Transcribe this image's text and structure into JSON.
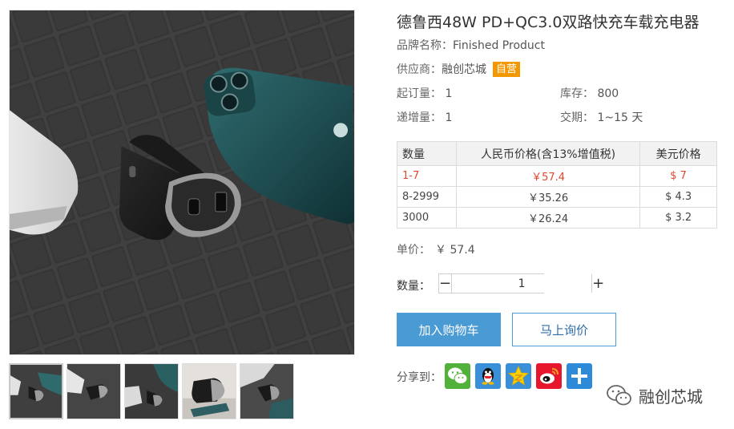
{
  "product": {
    "title": "德鲁西48W PD+QC3.0双路快充车载充电器",
    "brand_label": "品牌名称：",
    "brand_value": "Finished Product",
    "supplier_label": "供应商：",
    "supplier_value": "融创芯城",
    "self_run_badge": "自营",
    "moq_label": "起订量：",
    "moq_value": "1",
    "stock_label": "库存：",
    "stock_value": "800",
    "increment_label": "递增量：",
    "increment_value": "1",
    "leadtime_label": "交期：",
    "leadtime_value": "1~15 天"
  },
  "price_table": {
    "headers": [
      "数量",
      "人民币价格(含13%增值税)",
      "美元价格"
    ],
    "rows": [
      {
        "qty": "1-7",
        "rmb": "￥57.4",
        "usd": "$ 7",
        "highlight": true
      },
      {
        "qty": "8-2999",
        "rmb": "￥35.26",
        "usd": "$ 4.3",
        "highlight": false
      },
      {
        "qty": "3000",
        "rmb": "￥26.24",
        "usd": "$ 3.2",
        "highlight": false
      }
    ]
  },
  "unit_price": {
    "label": "单价：",
    "value": "￥ 57.4"
  },
  "quantity": {
    "label": "数量：",
    "minus": "−",
    "value": "1",
    "plus": "+"
  },
  "actions": {
    "add_to_cart": "加入购物车",
    "inquire": "马上询价"
  },
  "share": {
    "label": "分享到：",
    "icons": [
      "wechat-icon",
      "qq-icon",
      "qzone-icon",
      "weibo-icon",
      "more-share-icon"
    ]
  },
  "watermark": {
    "text": "融创芯城",
    "icon": "wechat-logo-icon"
  },
  "gallery": {
    "thumbnail_count": 5,
    "active_index": 0
  },
  "colors": {
    "accent_blue": "#4a9ad4",
    "badge_orange": "#f39800",
    "price_red": "#e2472f"
  }
}
